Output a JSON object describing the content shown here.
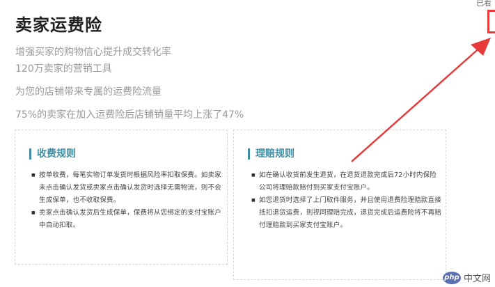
{
  "title": "卖家运费险",
  "corner_text": "已看",
  "intro": [
    "增强买家的购物信心提升成交转化率",
    "120万卖家的营销工具",
    "为您的店铺带来专属的运费险流量",
    "75%的卖家在加入运费险后店铺销量平均上涨了47%"
  ],
  "fee_rules": {
    "heading": "收费规则",
    "items": [
      "按单收费，每笔实物订单发货时根据风险率扣取保费。如卖家未点击确认发货或卖家点击确认发货时选择无需物流，则不会生成保单，也不收取保费。",
      "卖家点击确认发货后生成保单，保费将从您绑定的支付宝账户中自动扣取。"
    ]
  },
  "claim_rules": {
    "heading": "理赔规则",
    "items": [
      "如在确认收货前发生退货，在退货退款完成后72小时内保险公司将理赔款赔付到买家支付宝账户。",
      "如您退货时选择了上门取件服务，并且使用退费险理赔款直接抵扣退货运费，则视同理赔完成，退货完成后运费险将不再赔付理赔款到买家支付宝账户。"
    ]
  },
  "watermark": {
    "logo": "php",
    "text": "中文网"
  },
  "annotation_color": "#e73b3b",
  "accent_color": "#3f8ea3"
}
